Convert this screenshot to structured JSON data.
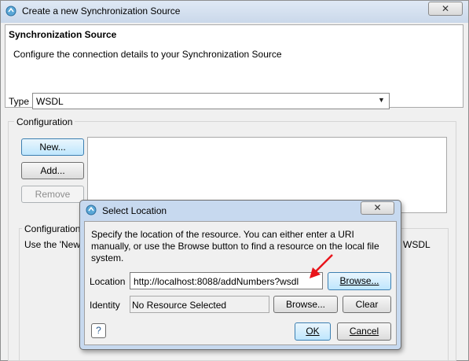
{
  "window": {
    "title": "Create a new Synchronization Source",
    "close_glyph": "✕"
  },
  "header": {
    "title": "Synchronization Source",
    "description": "Configure the connection details to your Synchronization Source"
  },
  "type": {
    "label": "Type",
    "value": "WSDL"
  },
  "configuration": {
    "label": "Configuration",
    "new_label": "New...",
    "add_label": "Add...",
    "remove_label": "Remove",
    "sub_label": "Configuration",
    "use_text": "Use the 'New",
    "wsdl_fragment": "WSDL"
  },
  "dialog": {
    "title": "Select Location",
    "close_glyph": "✕",
    "description": "Specify the location of the resource.  You can either enter a URI manually, or use the Browse button to find a resource on the local file system.",
    "location_label": "Location",
    "location_value": "http://localhost:8088/addNumbers?wsdl",
    "browse_label": "Browse...",
    "identity_label": "Identity",
    "identity_value": "No Resource Selected",
    "browse2_label": "Browse...",
    "clear_label": "Clear",
    "help_glyph": "?",
    "ok_label": "OK",
    "cancel_label": "Cancel"
  },
  "colors": {
    "annotation_arrow": "#e8141b",
    "default_button": "#bee6fd"
  },
  "icons": [
    "sync-source-icon",
    "close-icon",
    "chevron-down-icon",
    "help-icon",
    "red-arrow-annotation-icon"
  ]
}
